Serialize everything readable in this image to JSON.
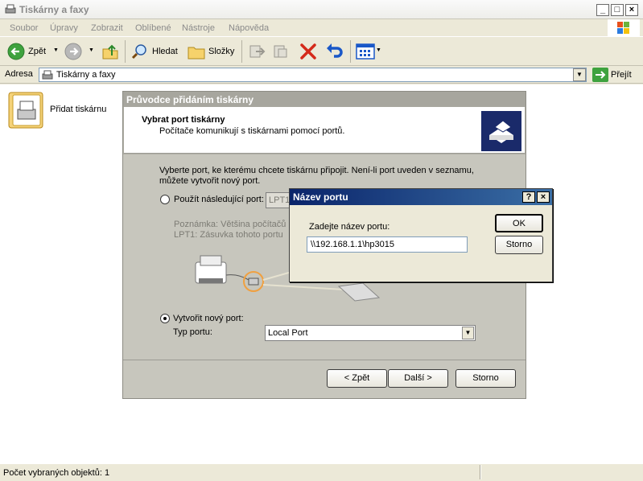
{
  "window": {
    "title": "Tiskárny a faxy"
  },
  "menu": [
    "Soubor",
    "Úpravy",
    "Zobrazit",
    "Oblíbené",
    "Nástroje",
    "Nápověda"
  ],
  "toolbar": {
    "back": "Zpět",
    "search": "Hledat",
    "folders": "Složky"
  },
  "address": {
    "label": "Adresa",
    "value": "Tiskárny a faxy",
    "go": "Přejít"
  },
  "sidebar_item": {
    "label": "Přidat tiskárnu"
  },
  "status": {
    "text": "Počet vybraných objektů: 1"
  },
  "wizard": {
    "title": "Průvodce přidáním tiskárny",
    "header_title": "Vybrat port tiskárny",
    "header_subtitle": "Počítače komunikují s tiskárnami pomocí portů.",
    "instruction_line1": "Vyberte port, ke kterému chcete tiskárnu připojit. Není-li port uveden v seznamu,",
    "instruction_line2": "můžete vytvořit nový port.",
    "use_port_label": "Použít následující port:",
    "use_port_value": "LPT1",
    "note_line1": "Poznámka: Většina počítačů",
    "note_line2": "LPT1: Zásuvka tohoto portu",
    "new_port_label": "Vytvořit nový port:",
    "port_type_label": "Typ portu:",
    "port_type_value": "Local Port",
    "back_button": "< Zpět",
    "next_button": "Další >",
    "cancel_button": "Storno"
  },
  "dialog": {
    "title": "Název portu",
    "help": "?",
    "close": "×",
    "prompt": "Zadejte název portu:",
    "value": "\\\\192.168.1.1\\hp3015",
    "ok": "OK",
    "cancel": "Storno"
  }
}
